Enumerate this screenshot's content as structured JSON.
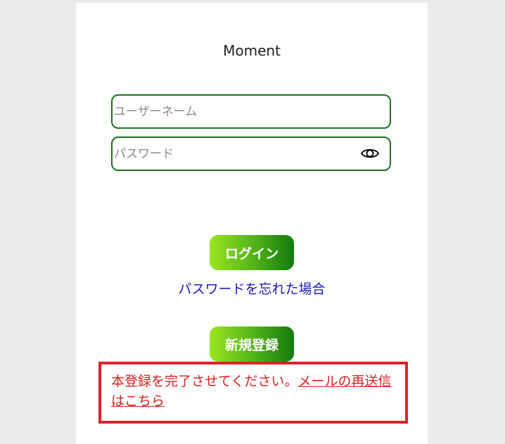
{
  "app": {
    "title": "Moment"
  },
  "login_form": {
    "username_placeholder": "ユーザーネーム",
    "username_value": "",
    "password_placeholder": "パスワード",
    "password_value": "",
    "toggle_visibility_icon": "eye-icon",
    "login_label": "ログイン",
    "forgot_password_label": "パスワードを忘れた場合",
    "register_label": "新規登録"
  },
  "notice": {
    "message": "本登録を完了させてください。",
    "resend_link": "メールの再送信はこちら"
  },
  "colors": {
    "field_border": "#1f6f1f",
    "button_gradient_start": "#9be61d",
    "button_gradient_end": "#127a10",
    "link": "#1a1ab8",
    "error": "#d61f1f",
    "error_border": "#e0202a",
    "page_background": "#ebebeb"
  }
}
